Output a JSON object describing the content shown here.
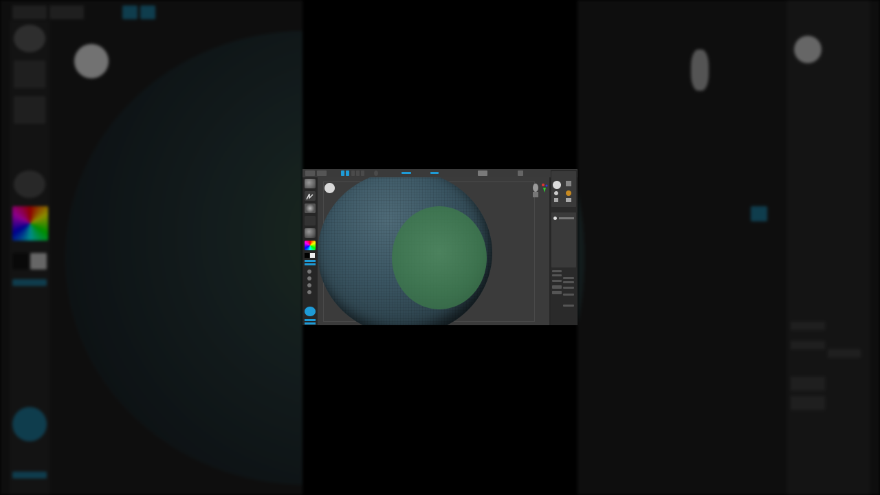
{
  "window": {
    "title": "",
    "app": "sculpting-application"
  },
  "colors": {
    "accent": "#1e9bd7",
    "mask": "#3f7a4e",
    "mesh": "#3a5562",
    "ui_bg": "#2d2d2d"
  },
  "icons": {
    "brush": "brush-icon",
    "stroke": "stroke-icon",
    "alpha": "alpha-icon",
    "material": "material-icon",
    "color_picker": "color-picker-icon",
    "gizmo": "axis-gizmo-icon",
    "head": "head-thumbnail-icon"
  }
}
